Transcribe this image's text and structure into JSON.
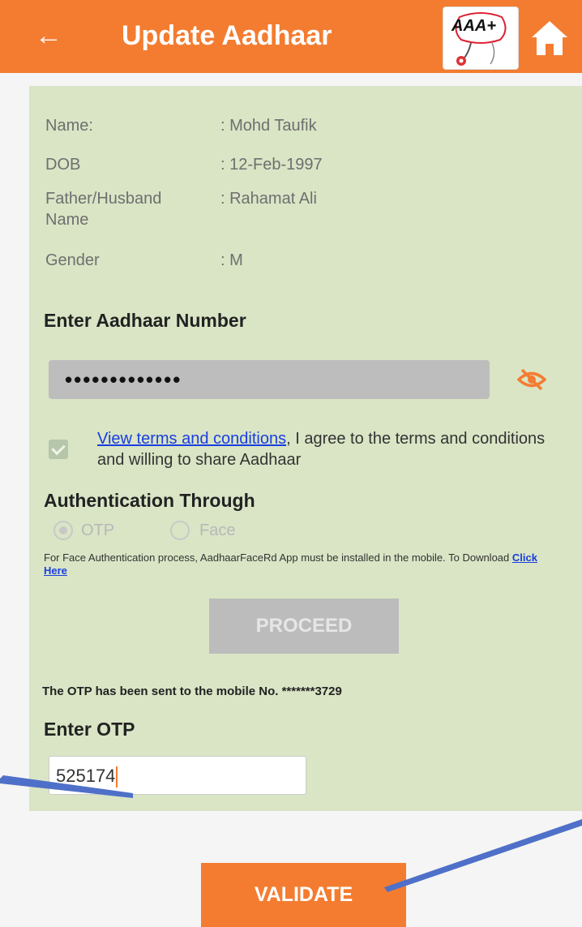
{
  "header": {
    "title": "Update Aadhaar",
    "logo_text": "AAA+",
    "color": "#f47c30"
  },
  "details": [
    {
      "label": "Name:",
      "value": ": Mohd Taufik"
    },
    {
      "label": "DOB",
      "value": ": 12-Feb-1997"
    },
    {
      "label": "Father/Husband Name",
      "value": ": Rahamat Ali"
    },
    {
      "label": "Gender",
      "value": ": M"
    }
  ],
  "aadhaar": {
    "heading": "Enter Aadhaar Number",
    "masked_value": "•••••••••••••"
  },
  "terms": {
    "link_text": "View terms and conditions",
    "text": ", I agree to the terms and conditions and willing to share Aadhaar"
  },
  "auth": {
    "heading": "Authentication Through",
    "options": [
      "OTP",
      "Face"
    ],
    "selected": "OTP",
    "note": "For Face Authentication process, AadhaarFaceRd App must be installed in the mobile. To Download",
    "note_link": "Click Here"
  },
  "proceed_label": "PROCEED",
  "otp": {
    "sent_message": "The OTP has been sent to the mobile No. *******3729",
    "heading": "Enter OTP",
    "value": "525174"
  },
  "validate_label": "VALIDATE"
}
